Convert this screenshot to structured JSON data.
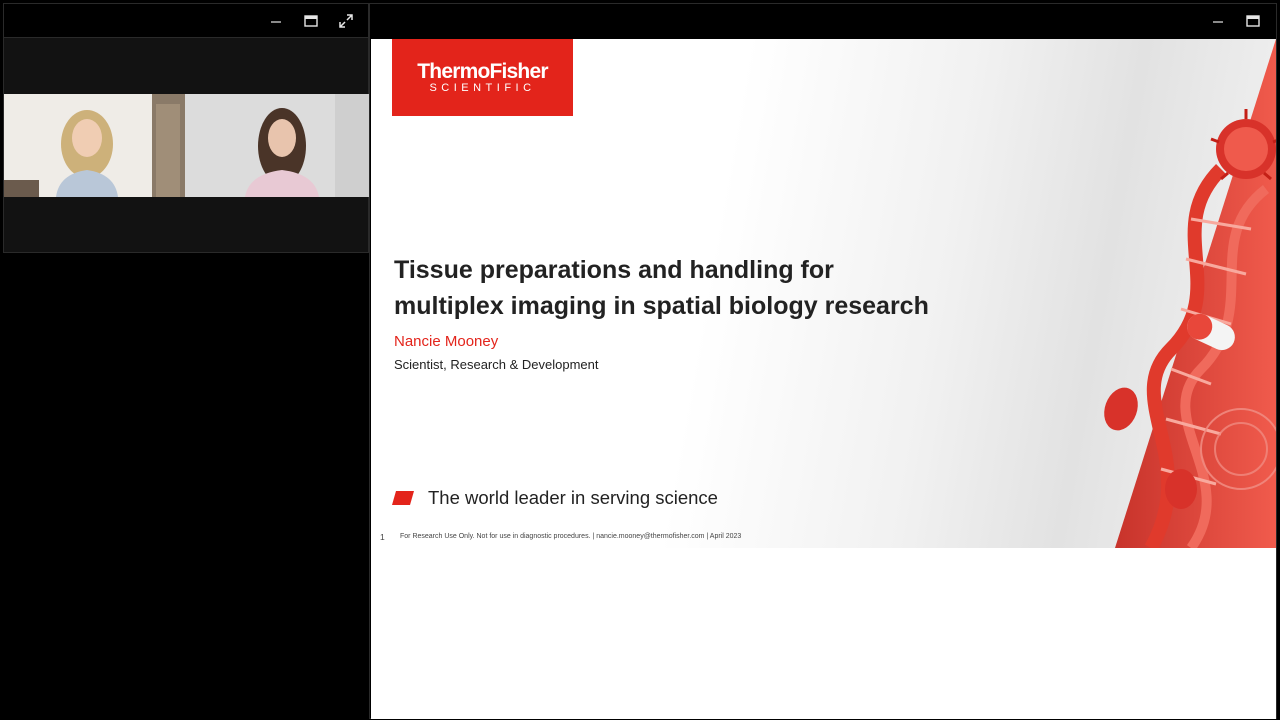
{
  "video_panel": {
    "controls": {
      "minimize_icon": "minimize-icon",
      "restore_icon": "restore-window-icon",
      "expand_icon": "expand-icon"
    },
    "participants": [
      {
        "id": "participant-1"
      },
      {
        "id": "participant-2"
      }
    ]
  },
  "share_window": {
    "controls": {
      "minimize_icon": "minimize-icon",
      "restore_icon": "restore-window-icon"
    }
  },
  "slide": {
    "logo_main": "ThermoFisher",
    "logo_sub": "SCIENTIFIC",
    "title_line1": "Tissue preparations and handling for",
    "title_line2": "multiplex imaging in spatial biology research",
    "presenter_name": "Nancie Mooney",
    "presenter_role": "Scientist, Research & Development",
    "tagline": "The world leader in serving science",
    "slide_number": "1",
    "footer": "For Research Use Only. Not for use in diagnostic procedures.  |  nancie.mooney@thermofisher.com | April 2023"
  },
  "colors": {
    "brand_red": "#e3241b",
    "text_dark": "#222222",
    "panel_bg": "#121212"
  }
}
